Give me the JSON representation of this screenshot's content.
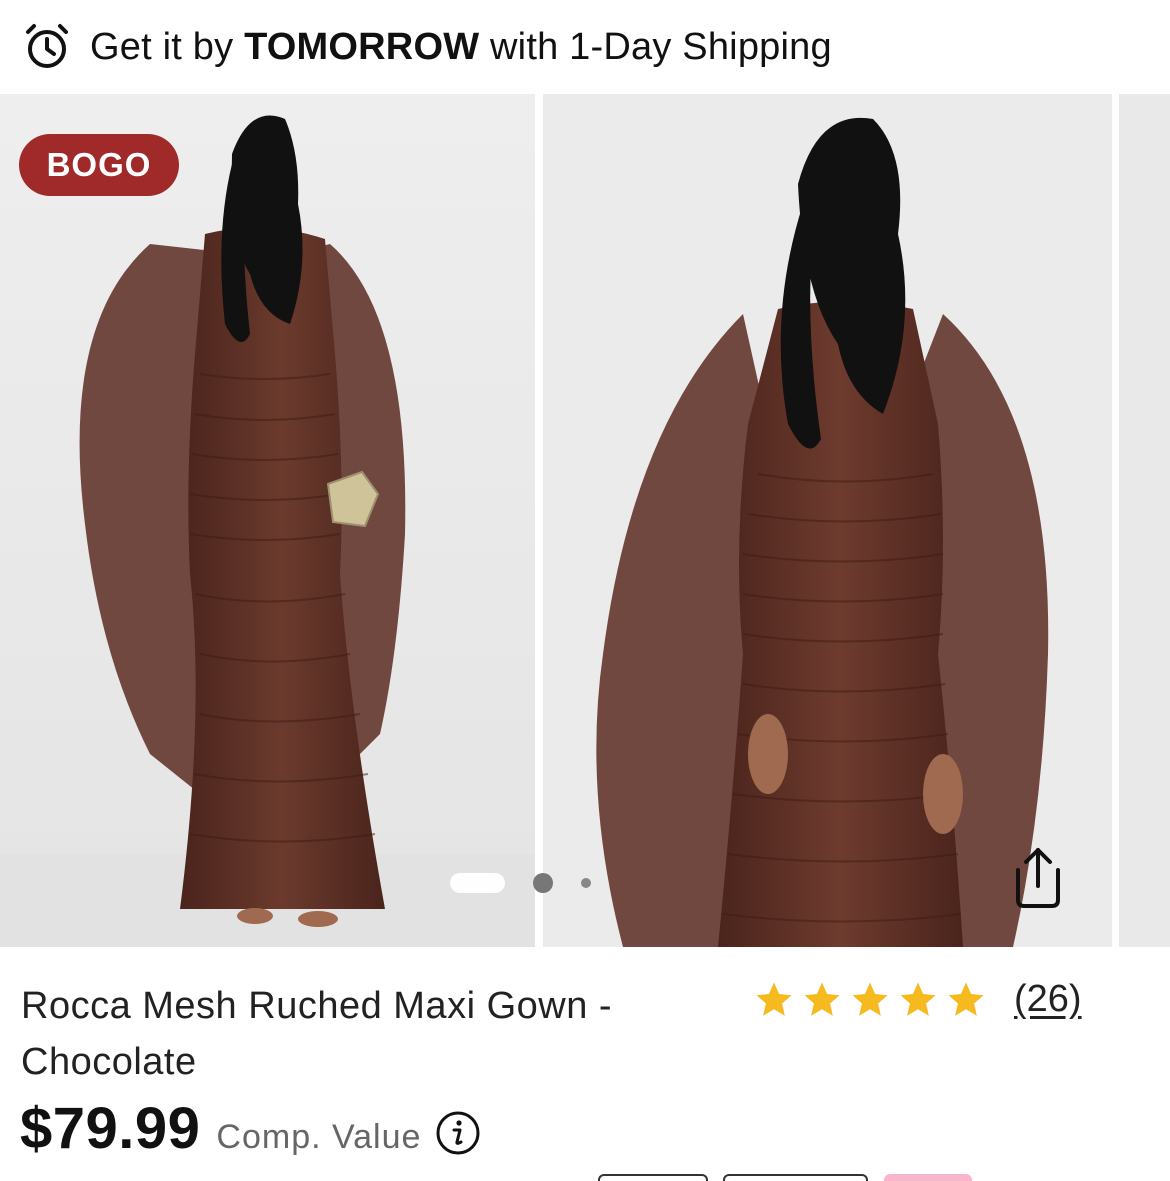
{
  "shipping": {
    "prefix": "Get it by ",
    "emphasis": "TOMORROW",
    "suffix": " with 1-Day Shipping"
  },
  "gallery": {
    "badge": "BOGO",
    "dots_total": 3,
    "dots_active_index": 0,
    "dress_color": "#5a2c22"
  },
  "product": {
    "title": "Rocca Mesh Ruched Maxi Gown - Chocolate",
    "rating_stars": 5,
    "review_count": "(26)",
    "price": "$79.99",
    "comp_value_label": "Comp. Value"
  },
  "colors": {
    "badge": "#a02a2a",
    "star": "#f6b91e",
    "chip_pink": "#f8b6cc"
  },
  "icons": {
    "shipping": "alarm-clock-icon",
    "share": "share-upload-icon",
    "info": "info-icon",
    "star": "star-icon"
  }
}
